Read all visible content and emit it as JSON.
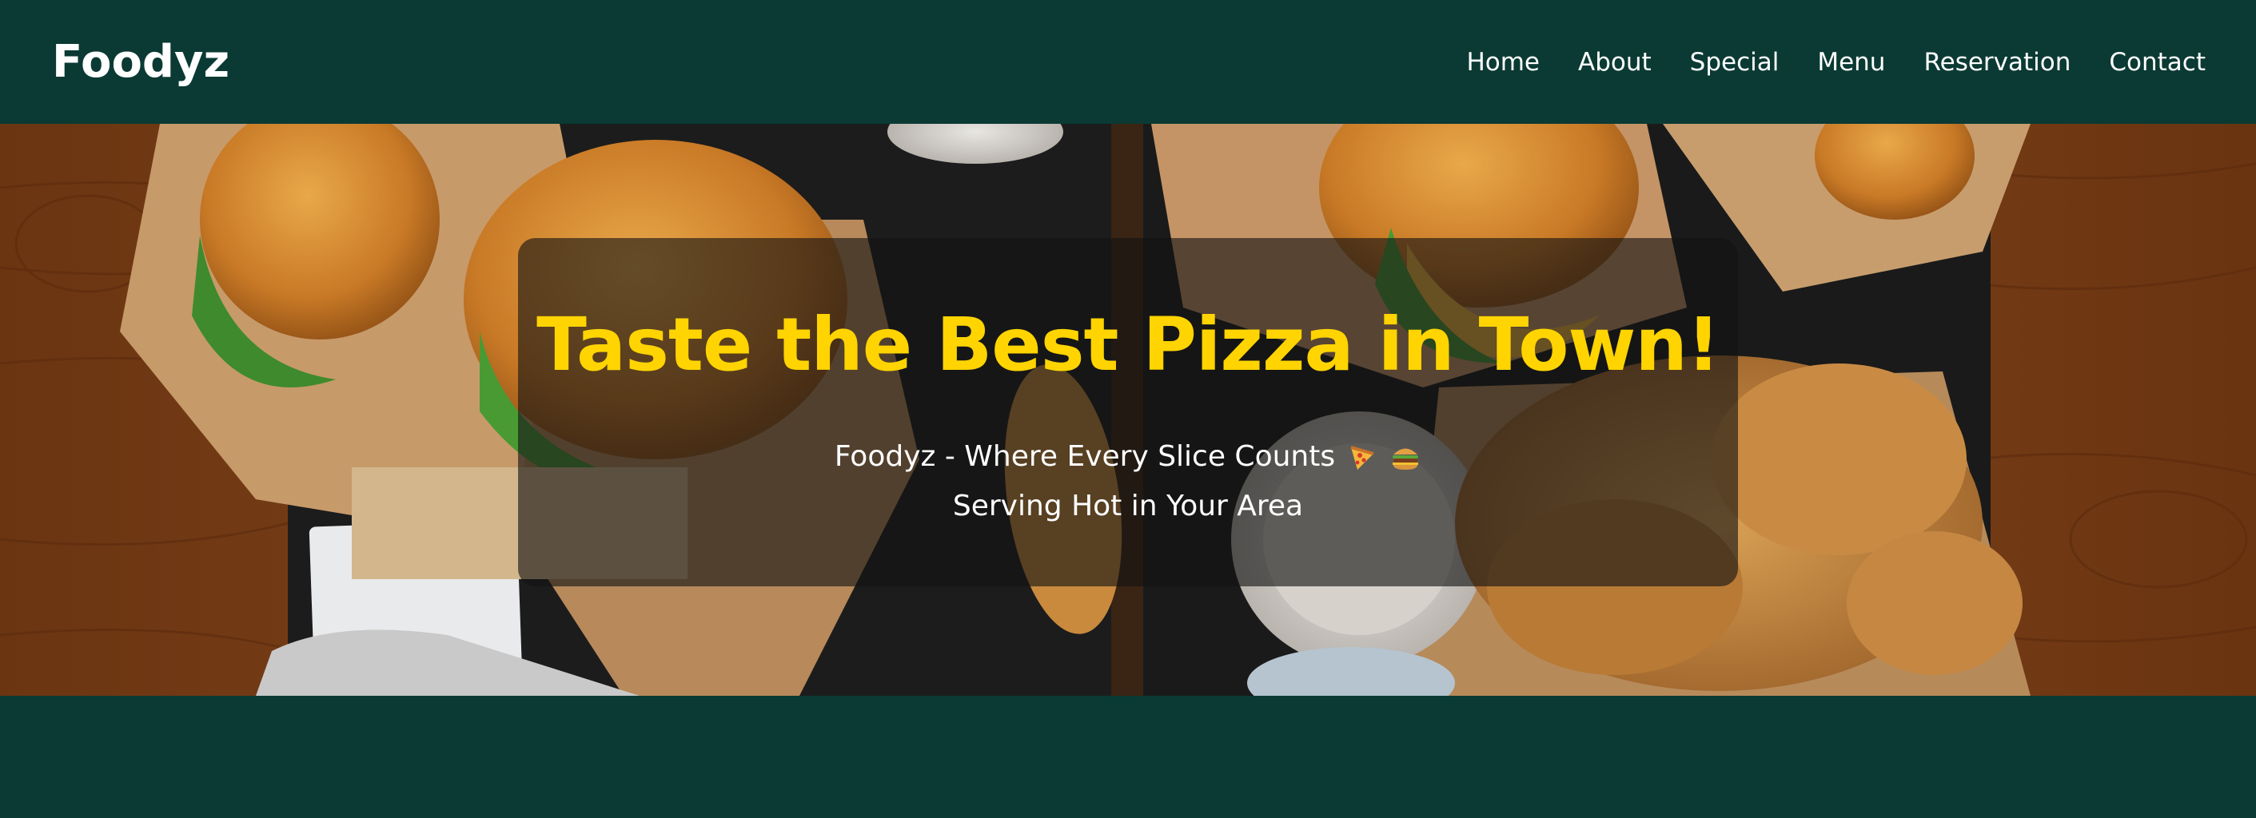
{
  "brand": {
    "name": "Foodyz"
  },
  "nav": {
    "items": [
      {
        "label": "Home"
      },
      {
        "label": "About"
      },
      {
        "label": "Special"
      },
      {
        "label": "Menu"
      },
      {
        "label": "Reservation"
      },
      {
        "label": "Contact"
      }
    ]
  },
  "hero": {
    "title": "Taste the Best Pizza in Town!",
    "subtitle_line1": "Foodyz - Where Every Slice Counts",
    "subtitle_line2": "Serving Hot in Your Area",
    "icons": [
      "pizza-emoji",
      "burger-emoji"
    ]
  },
  "colors": {
    "nav_bg": "#0a3a33",
    "title": "#ffd400",
    "text": "#ffffff",
    "card_overlay": "rgba(20,20,20,0.62)"
  }
}
